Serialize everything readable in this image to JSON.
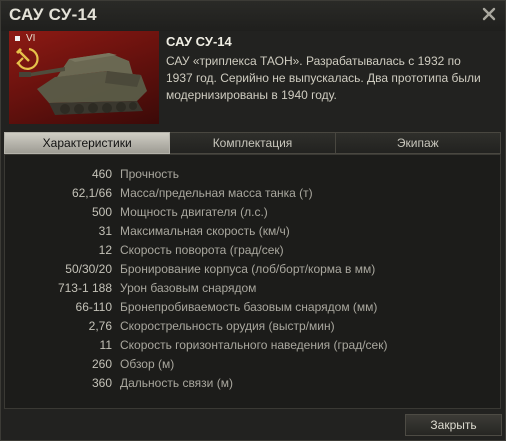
{
  "window": {
    "title": "САУ СУ-14"
  },
  "vehicle": {
    "tier": "VI",
    "name": "САУ СУ-14",
    "description": "САУ «триплекса ТАОН». Разрабатывалась с 1932 по 1937 год. Серийно не выпускалась. Два прототипа были модернизированы в 1940 году."
  },
  "tabs": [
    {
      "label": "Характеристики",
      "active": true
    },
    {
      "label": "Комплектация",
      "active": false
    },
    {
      "label": "Экипаж",
      "active": false
    }
  ],
  "stats": [
    {
      "value": "460",
      "label": "Прочность"
    },
    {
      "value": "62,1/66",
      "label": "Масса/предельная масса танка (т)"
    },
    {
      "value": "500",
      "label": "Мощность двигателя (л.с.)"
    },
    {
      "value": "31",
      "label": "Максимальная скорость (км/ч)"
    },
    {
      "value": "12",
      "label": "Скорость поворота (град/сек)"
    },
    {
      "value": "50/30/20",
      "label": "Бронирование корпуса (лоб/борт/корма в мм)"
    },
    {
      "value": "713-1 188",
      "label": "Урон базовым снарядом"
    },
    {
      "value": "66-110",
      "label": "Бронепробиваемость базовым снарядом (мм)"
    },
    {
      "value": "2,76",
      "label": "Скорострельность орудия (выстр/мин)"
    },
    {
      "value": "11",
      "label": "Скорость горизонтального наведения (град/сек)"
    },
    {
      "value": "260",
      "label": "Обзор (м)"
    },
    {
      "value": "360",
      "label": "Дальность связи (м)"
    }
  ],
  "footer": {
    "close_label": "Закрыть"
  },
  "colors": {
    "flag": "#8d1a14",
    "background": "#222220",
    "active_tab": "#cfcdc4"
  },
  "icons": {
    "close": "close-icon",
    "emblem": "hammer-sickle-icon",
    "tier": "tier-icon"
  }
}
